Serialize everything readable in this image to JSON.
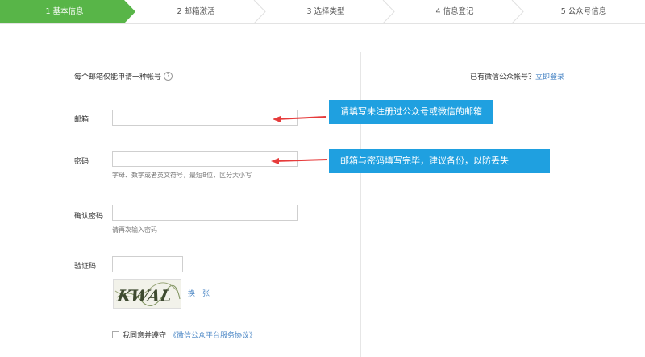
{
  "steps": [
    {
      "label": "1 基本信息",
      "active": true
    },
    {
      "label": "2 邮箱激活",
      "active": false
    },
    {
      "label": "3 选择类型",
      "active": false
    },
    {
      "label": "4 信息登记",
      "active": false
    },
    {
      "label": "5 公众号信息",
      "active": false
    }
  ],
  "form": {
    "hint": "每个邮箱仅能申请一种帐号",
    "email_label": "邮箱",
    "email_value": "",
    "password_label": "密码",
    "password_value": "",
    "password_note": "字母、数字或者英文符号，最短8位，区分大小写",
    "confirm_label": "确认密码",
    "confirm_value": "",
    "confirm_note": "请再次输入密码",
    "captcha_label": "验证码",
    "captcha_value": "",
    "captcha_text": "KWAL",
    "refresh_label": "换一张",
    "agree_text": "我同意并遵守",
    "agree_link": "《微信公众平台服务协议》"
  },
  "side": {
    "have_account": "已有微信公众帐号？",
    "login_link": "立即登录"
  },
  "callouts": {
    "email_tip": "请填写未注册过公众号或微信的邮箱",
    "password_tip": "邮箱与密码填写完毕，建议备份，以防丢失"
  },
  "colors": {
    "active_step": "#58b548",
    "callout": "#1fa0e0",
    "link": "#4a86c5",
    "arrow": "#e63b3b"
  }
}
